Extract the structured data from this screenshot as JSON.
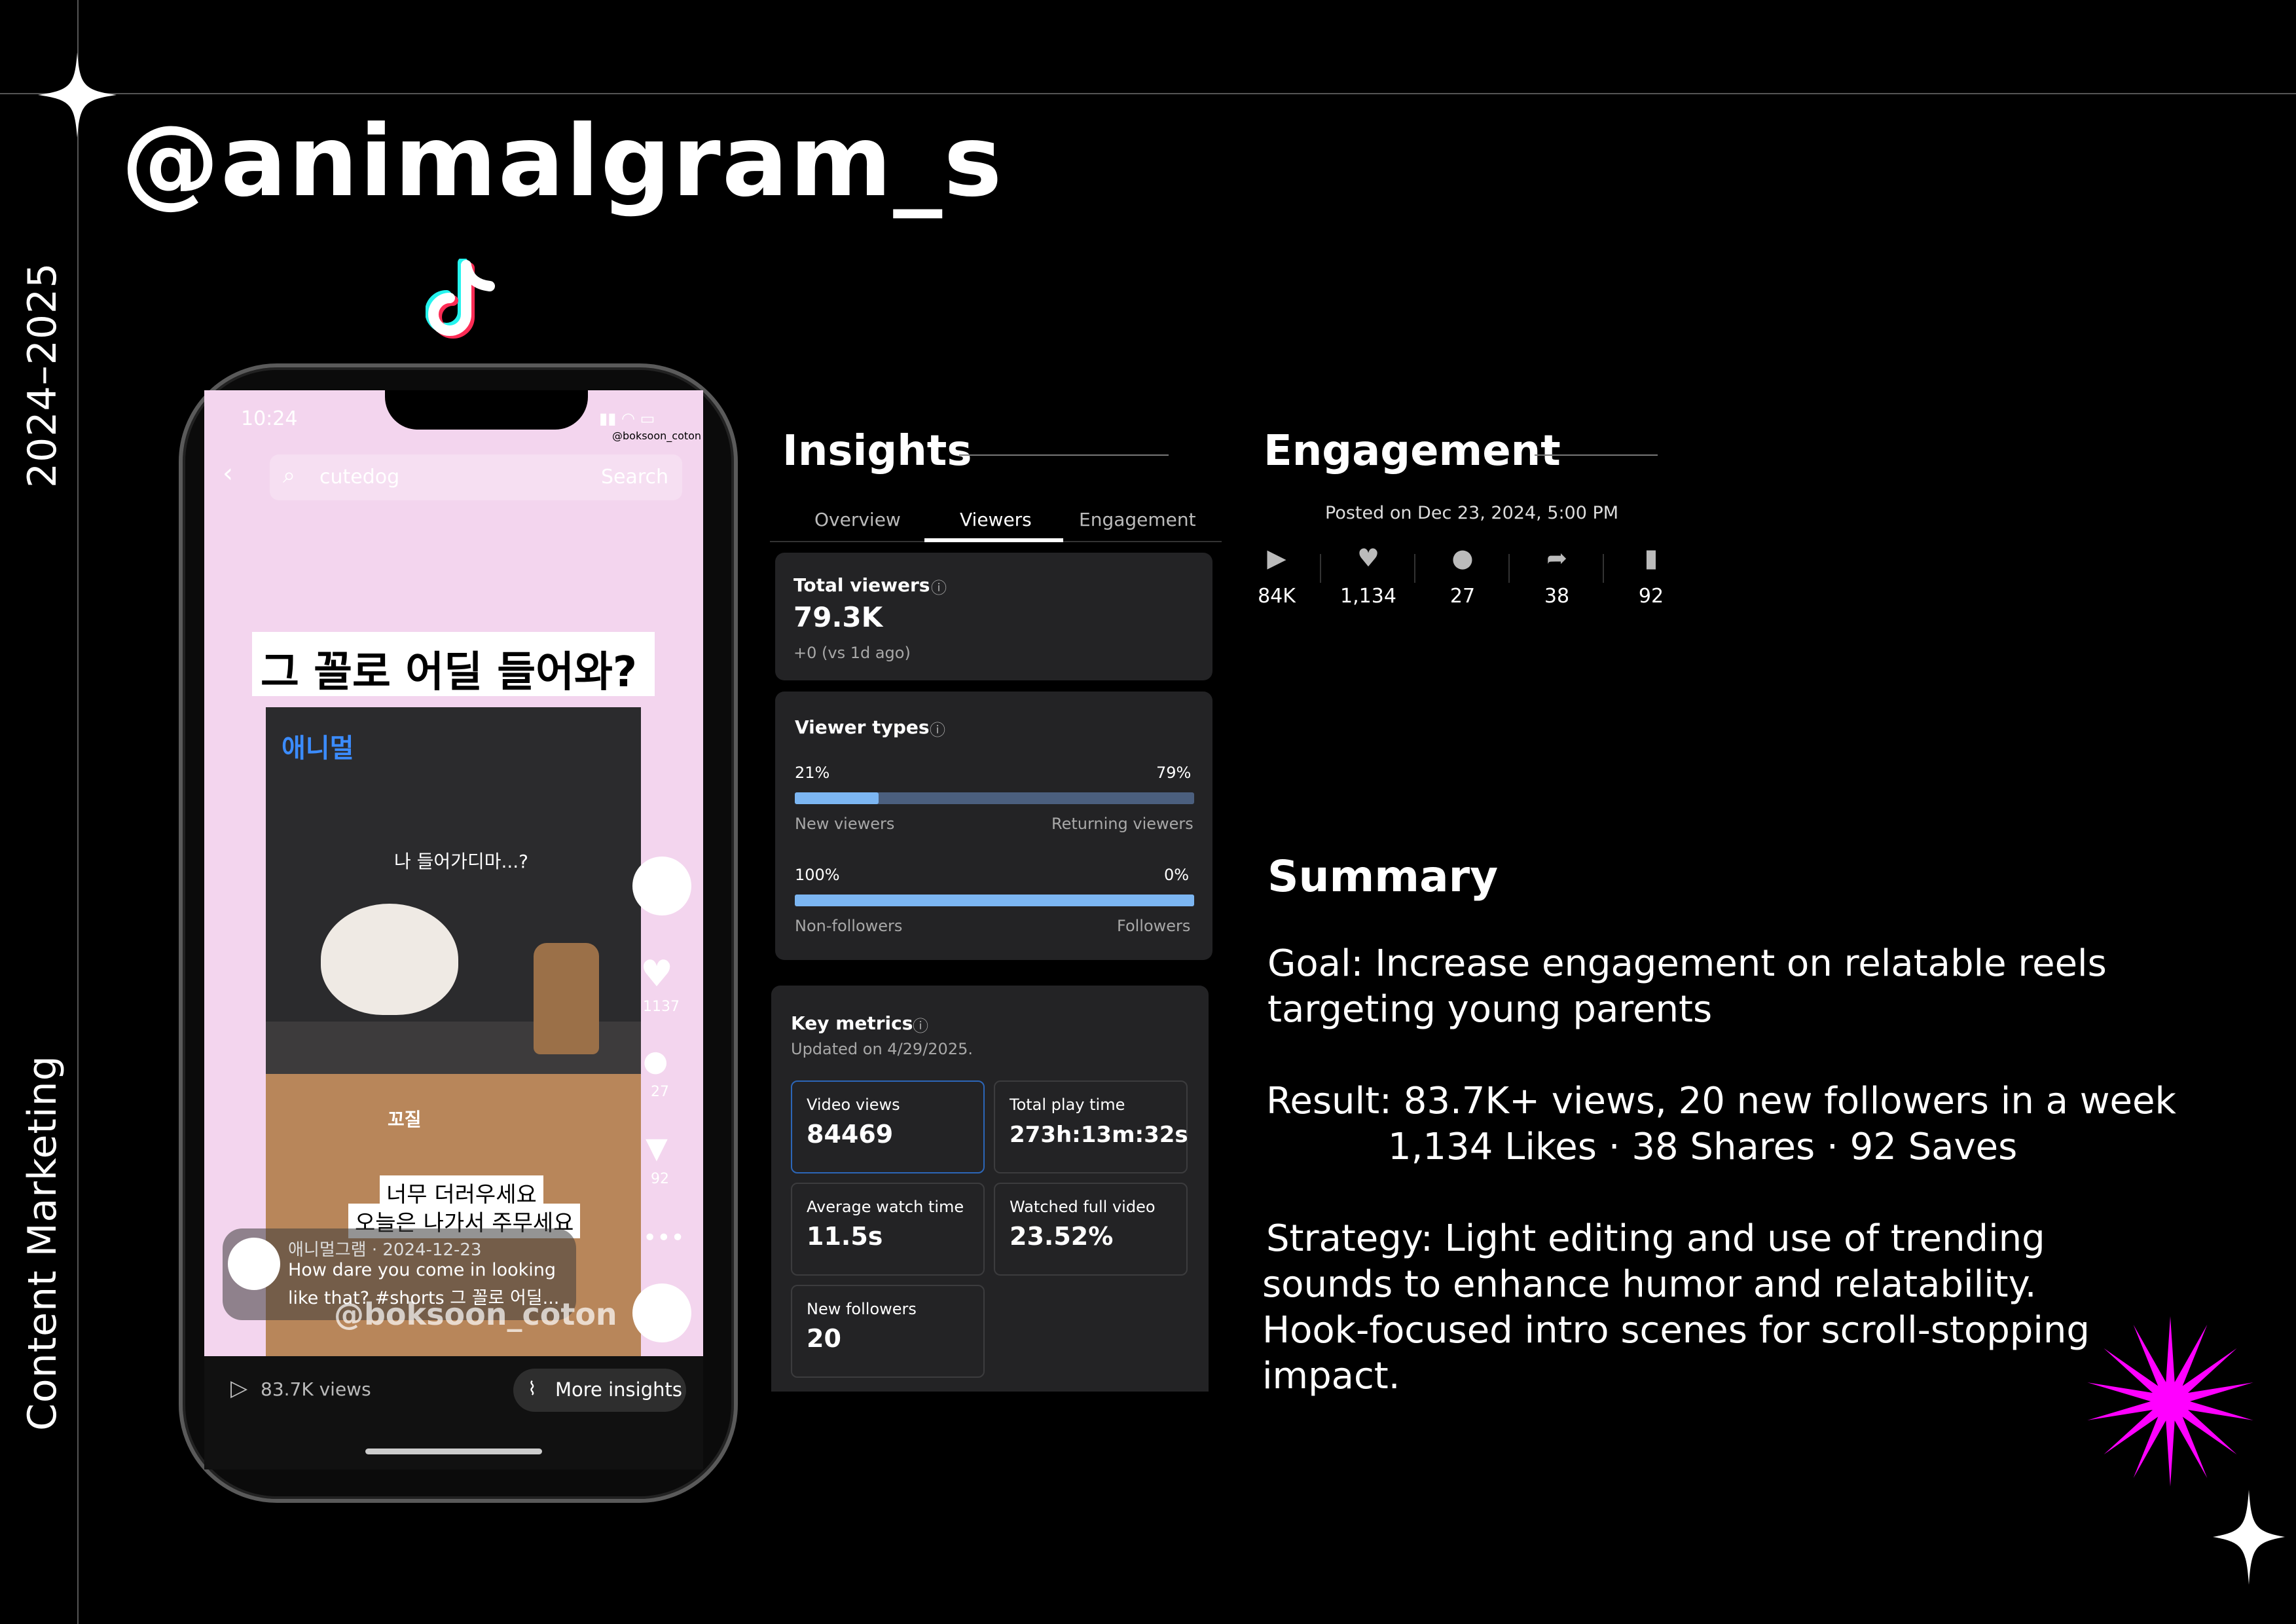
{
  "page": {
    "handle": "@animalgram_s",
    "years": "2024–2025",
    "category": "Content Marketing"
  },
  "phone": {
    "time": "10:24",
    "search_value": "cutedog",
    "search_button": "Search",
    "watermark_small": "@boksoon_coton",
    "headline_kr": "그 꼴로 어딜 들어와?",
    "video_text_1": "나 들어가디마...?",
    "video_text_2": "꼬질",
    "video_text_3": "너무 더러우세요",
    "video_text_4": "오늘은 나가서 주무세요",
    "side_likes": "1137",
    "side_comments": "27",
    "side_saves": "92",
    "caption_meta": "애니멀그램 · 2024-12-23",
    "caption_line1": "How dare you come in looking",
    "caption_line2": "like that? #shorts 그 꼴로 어딜...",
    "watermark_big": "@boksoon_coton",
    "views": "83.7K views",
    "more_insights": "More insights"
  },
  "insights": {
    "heading": "Insights",
    "tabs": [
      "Overview",
      "Viewers",
      "Engagement"
    ],
    "active_tab": "Viewers",
    "total_viewers": {
      "label": "Total viewers",
      "value": "79.3K",
      "delta": "+0  (vs 1d ago)"
    },
    "viewer_types": {
      "label": "Viewer types",
      "row1": {
        "left_pct": "21%",
        "right_pct": "79%",
        "left_label": "New viewers",
        "right_label": "Returning viewers",
        "fill": 0.21
      },
      "row2": {
        "left_pct": "100%",
        "right_pct": "0%",
        "left_label": "Non-followers",
        "right_label": "Followers",
        "fill": 1.0
      }
    },
    "key_metrics": {
      "label": "Key metrics",
      "updated": "Updated on 4/29/2025.",
      "items": [
        {
          "label": "Video views",
          "value": "84469"
        },
        {
          "label": "Total play time",
          "value": "273h:13m:32s"
        },
        {
          "label": "Average watch time",
          "value": "11.5s"
        },
        {
          "label": "Watched full video",
          "value": "23.52%"
        },
        {
          "label": "New followers",
          "value": "20"
        }
      ]
    }
  },
  "engagement": {
    "heading": "Engagement",
    "posted": "Posted on Dec 23, 2024, 5:00 PM",
    "stats": [
      {
        "icon": "play-icon",
        "value": "84K"
      },
      {
        "icon": "heart-icon",
        "value": "1,134"
      },
      {
        "icon": "comment-icon",
        "value": "27"
      },
      {
        "icon": "share-icon",
        "value": "38"
      },
      {
        "icon": "bookmark-icon",
        "value": "92"
      }
    ]
  },
  "summary": {
    "heading": "Summary",
    "goal_1": "Goal: Increase engagement on relatable reels",
    "goal_2": "targeting young parents",
    "result_1": "Result: 83.7K+ views, 20 new followers in a week",
    "result_2": "1,134 Likes · 38 Shares · 92 Saves",
    "strategy_1": "Strategy: Light editing and use of trending",
    "strategy_2": "sounds to enhance humor and relatability.",
    "strategy_3": "Hook-focused intro scenes for scroll-stopping",
    "strategy_4": "impact."
  },
  "colors": {
    "background": "#000000",
    "accent_magenta": "#ff00ff",
    "bar_blue": "#7cb6f2",
    "bar_track": "#4b5f7e",
    "tab_underline": "#ffffff"
  }
}
